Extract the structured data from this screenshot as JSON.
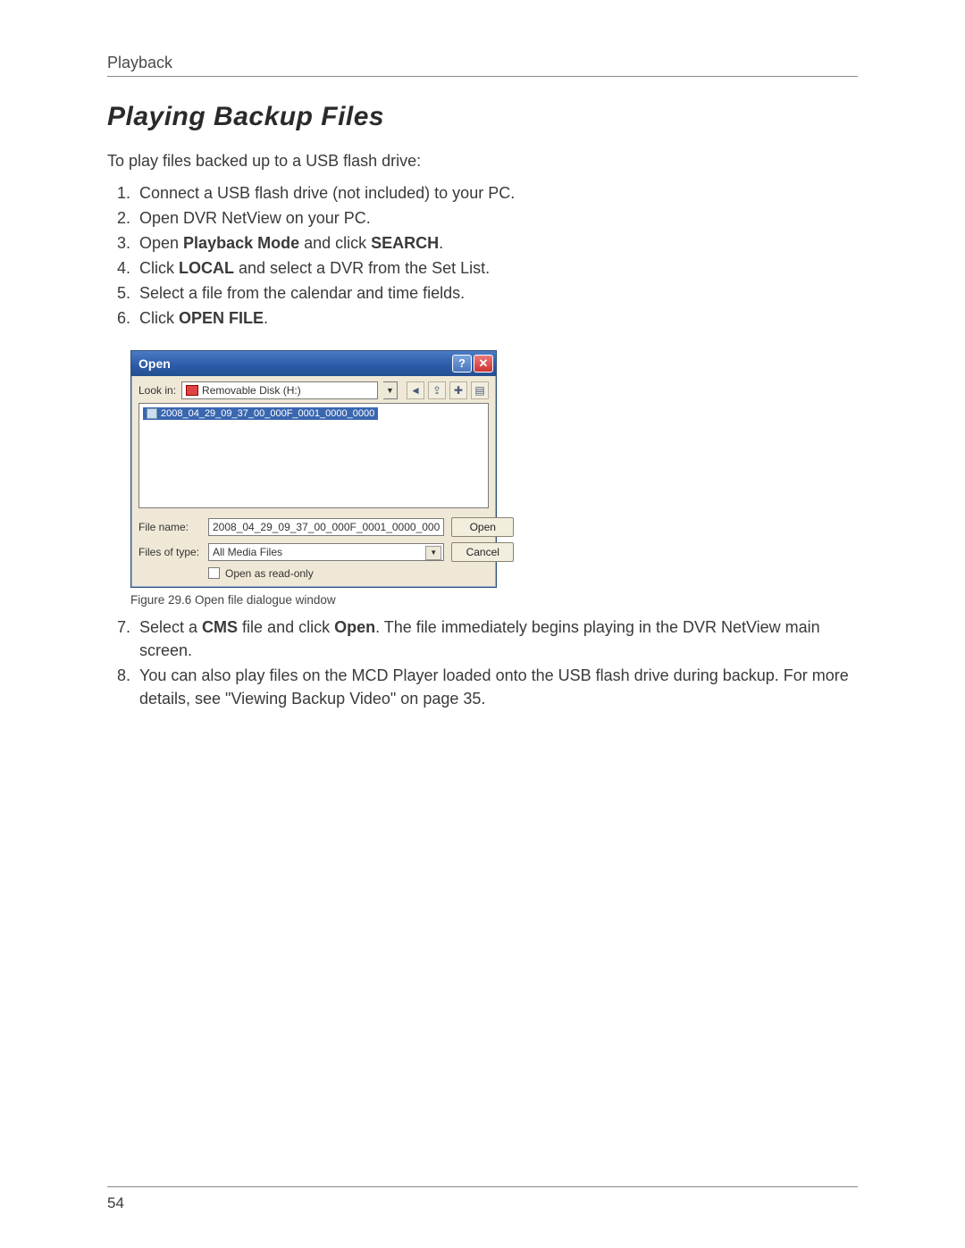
{
  "header": {
    "running": "Playback"
  },
  "title": "Playing Backup Files",
  "intro": "To play files backed up to a USB flash drive:",
  "steps1": [
    {
      "pre": "Connect a USB flash drive (not included) to your PC."
    },
    {
      "pre": "Open DVR NetView on your PC."
    },
    {
      "pre": "Open ",
      "b1": "Playback Mode",
      "mid": " and click ",
      "b2": "SEARCH",
      "post": "."
    },
    {
      "pre": "Click ",
      "b1": "LOCAL",
      "post": " and select a DVR from the Set List."
    },
    {
      "pre": "Select a file from the calendar and time fields."
    },
    {
      "pre": "Click ",
      "b1": "OPEN FILE",
      "post": "."
    }
  ],
  "dialog": {
    "title": "Open",
    "lookin_label": "Look in:",
    "lookin_value": "Removable Disk (H:)",
    "selected_file": "2008_04_29_09_37_00_000F_0001_0000_0000",
    "filename_label": "File name:",
    "filename_value": "2008_04_29_09_37_00_000F_0001_0000_000",
    "filetype_label": "Files of type:",
    "filetype_value": "All Media Files",
    "open_btn": "Open",
    "cancel_btn": "Cancel",
    "readonly_label": "Open as read-only"
  },
  "caption": "Figure 29.6 Open file dialogue window",
  "steps2": [
    {
      "pre": "Select a ",
      "b1": "CMS",
      "mid": " file and click ",
      "b2": "Open",
      "post": ". The file immediately begins playing in the DVR NetView main screen."
    },
    {
      "pre": "You can also play files on the MCD Player loaded onto the USB flash drive during backup. For more details, see \"Viewing Backup Video\" on page 35."
    }
  ],
  "page_number": "54"
}
